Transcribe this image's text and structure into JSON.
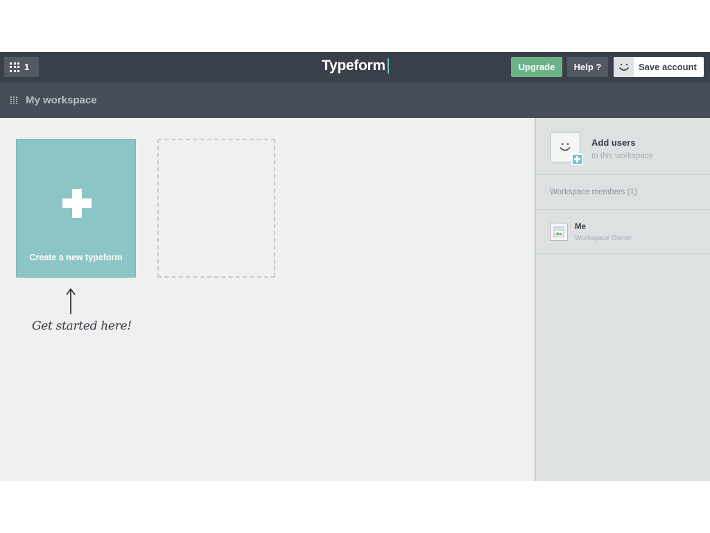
{
  "topbar": {
    "workspace_count": "1",
    "brand": "Typeform",
    "upgrade_label": "Upgrade",
    "help_label": "Help ?",
    "save_label": "Save account"
  },
  "subbar": {
    "title": "My workspace"
  },
  "main": {
    "create_label": "Create a new typeform",
    "hint_text": "Get started here!"
  },
  "sidebar": {
    "add_users_title": "Add users",
    "add_users_subtitle": "to this workspace",
    "members_heading": "Workspace members (1)",
    "members": [
      {
        "name": "Me",
        "role": "Workspace Owner"
      }
    ]
  },
  "icons": {
    "apps": "grid-icon",
    "face": "smiley-icon",
    "add": "plus-icon",
    "avatar": "broken-image-icon",
    "hint": "arrow-up-icon"
  },
  "colors": {
    "topbar": "#3a4049",
    "subbar": "#474e57",
    "upgrade": "#69b386",
    "create_card": "#8cc5c6",
    "accent": "#74c7cd",
    "sidebar": "#dde1e1"
  }
}
